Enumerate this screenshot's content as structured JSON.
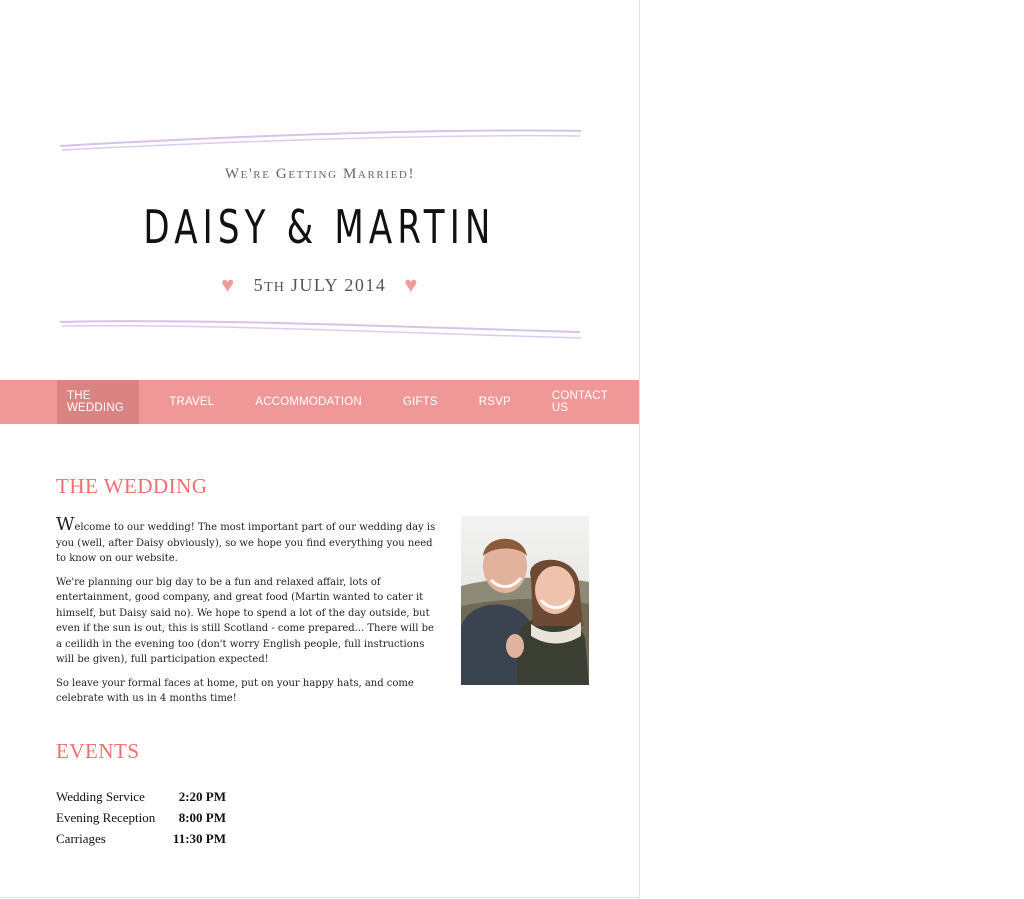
{
  "header": {
    "tagline": "We're Getting Married!",
    "couple": "DAISY & MARTIN",
    "date_day": "5",
    "date_suffix": "th",
    "date_rest": "JULY 2014",
    "heart_icon": "heart-icon",
    "heart_color": "#f09a9a"
  },
  "nav": {
    "items": [
      {
        "label": "THE WEDDING"
      },
      {
        "label": "TRAVEL"
      },
      {
        "label": "ACCOMMODATION"
      },
      {
        "label": "GIFTS"
      },
      {
        "label": "RSVP"
      },
      {
        "label": "CONTACT US"
      }
    ],
    "active_index": 0,
    "bar_color": "#f09898",
    "active_color": "#d98383"
  },
  "wedding": {
    "title": "THE WEDDING",
    "dropcap": "W",
    "p1_rest": "elcome to our wedding! The most important part of our wedding day is you (well, after Daisy obviously), so we hope you find everything you need to know on our website.",
    "p2": "We're planning our big day to be a fun and relaxed affair, lots of entertainment, good company, and great food (Martin wanted to cater it himself, but Daisy said no). We hope to spend a lot of the day outside, but even if the sun is out, this is still Scotland - come prepared... There will be a ceilidh in the evening too (don't worry English people, full instructions will be given), full participation expected!",
    "p3": "So leave your formal faces at home, put on your happy hats, and come celebrate with us in 4 months time!"
  },
  "events": {
    "title": "EVENTS",
    "rows": [
      {
        "name": "Wedding Service",
        "time": "2:20 PM"
      },
      {
        "name": "Evening Reception",
        "time": "8:00 PM"
      },
      {
        "name": "Carriages",
        "time": "11:30 PM"
      }
    ]
  },
  "colors": {
    "accent": "#ef6f6f",
    "decor_lines": "#d7c3ea"
  }
}
